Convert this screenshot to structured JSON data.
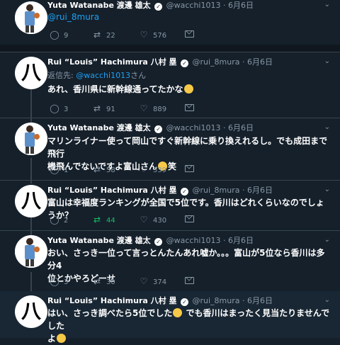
{
  "tweets": [
    {
      "name": "Yuta Watanabe 渡邊 雄太",
      "handle": "@wacchi1013",
      "dot": "·",
      "date": "6月6日",
      "body": "@rui_8mura",
      "replies": "9",
      "retweets": "22",
      "likes": "576"
    },
    {
      "name": "Rui “Louis” Hachimura 八村 塁",
      "handle": "@rui_8mura",
      "dot": "·",
      "date": "6月6日",
      "reply_prefix": "返信先:",
      "reply_handle": "@wacchi1013",
      "reply_suffix": "さん",
      "body": "あれ、香川県に新幹線通ってたかな",
      "replies": "3",
      "retweets": "91",
      "likes": "889"
    },
    {
      "name": "Yuta Watanabe 渡邊 雄太",
      "handle": "@wacchi1013",
      "dot": "·",
      "date": "6月6日",
      "body_line1": "マリンライナー使って岡山ですぐ新幹線に乗り換えれるし。でも成田まで飛行",
      "body_line2": "機飛んでないですよ富山さん",
      "body_tail": "笑",
      "replies": "1",
      "retweets": "58",
      "likes": "539"
    },
    {
      "name": "Rui “Louis” Hachimura 八村 塁",
      "handle": "@rui_8mura",
      "dot": "·",
      "date": "6月6日",
      "body": "富山は幸福度ランキングが全国で5位です。香川はどれくらいなのでしょうか？",
      "replies": "2",
      "retweets": "44",
      "likes": "430"
    },
    {
      "name": "Yuta Watanabe 渡邊 雄太",
      "handle": "@wacchi1013",
      "dot": "·",
      "date": "6月6日",
      "body_line1": "おい、さっき一位って言っとんたんあれ嘘か。。。富山が5位なら香川は多分4",
      "body_line2": "位とかやろどーせ",
      "replies": "3",
      "retweets": "30",
      "likes": "374"
    },
    {
      "name": "Rui “Louis” Hachimura 八村 塁",
      "handle": "@rui_8mura",
      "dot": "·",
      "date": "6月6日",
      "body_line1a": "はい、さっき調べたら5位でした",
      "body_line1b": "でも香川はまったく見当たりませんでした",
      "body_line2": "よ"
    }
  ],
  "avatar_rui_glyph": "八",
  "verified_glyph": "✓",
  "colors": {
    "bg": "#15202b",
    "alt_bg": "#192734",
    "muted": "#8899a6",
    "link": "#1da1f2",
    "retweet_active": "#17bf63"
  }
}
